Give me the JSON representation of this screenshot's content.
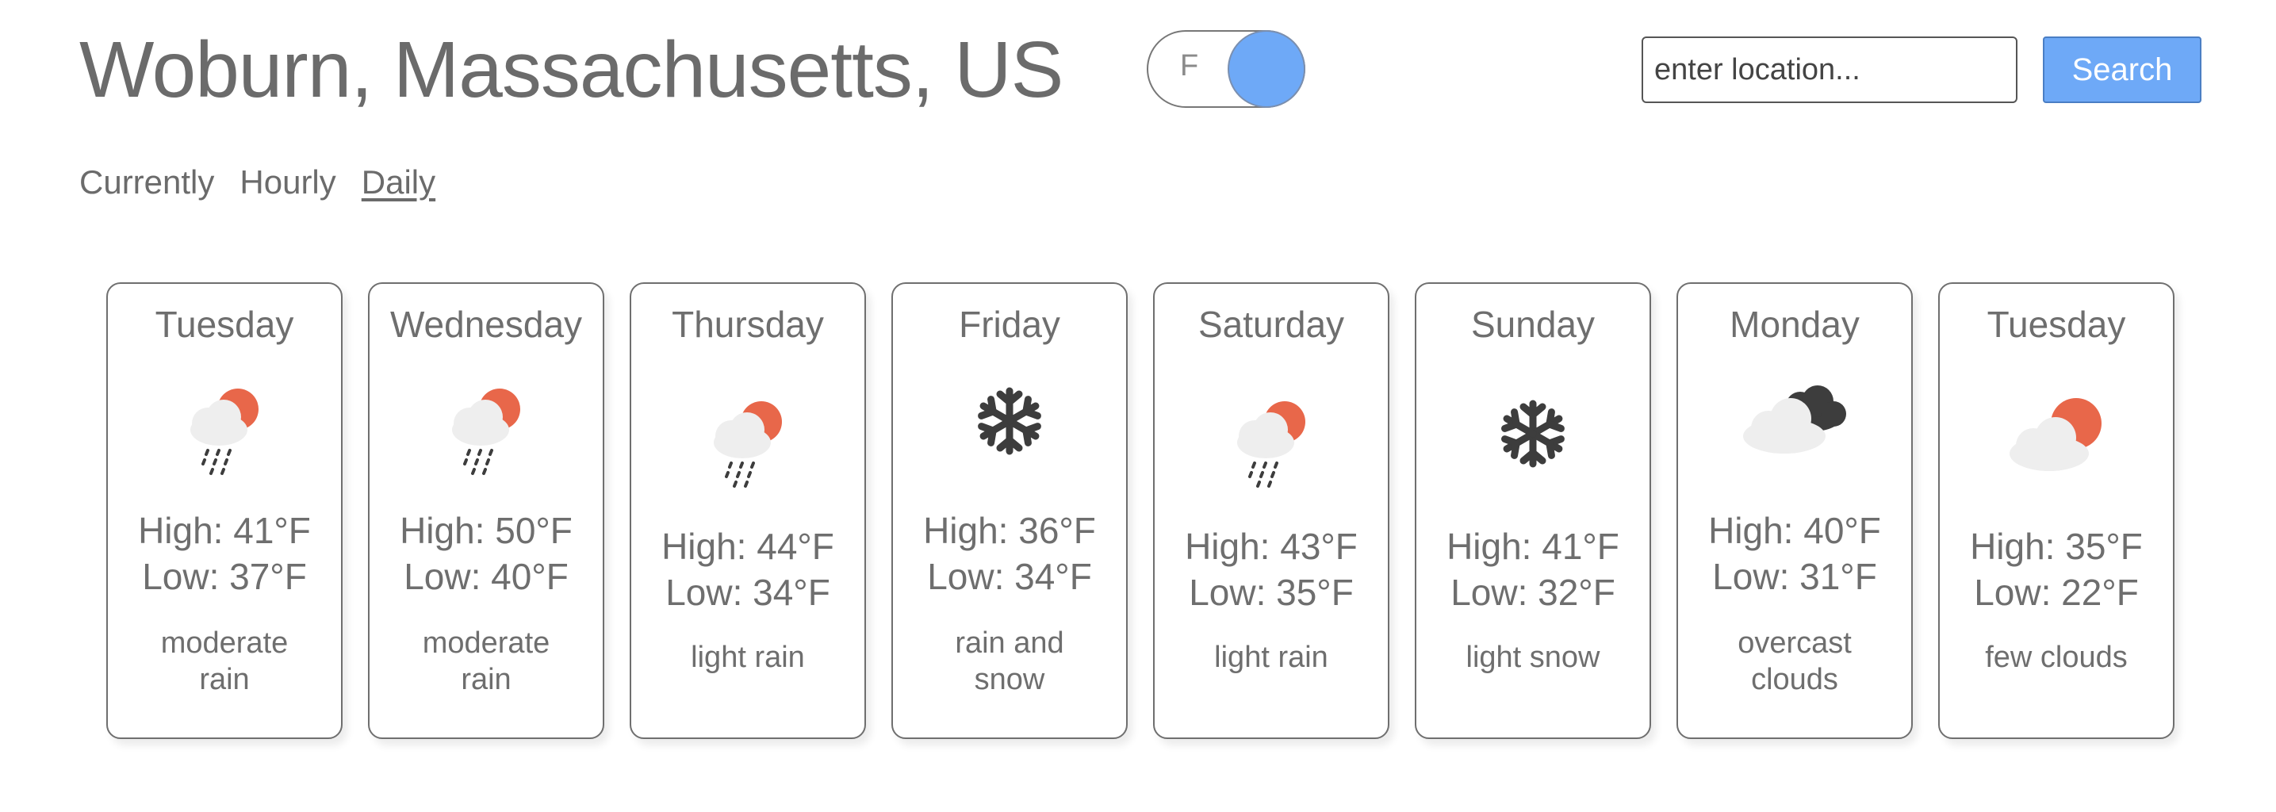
{
  "header": {
    "location": "Woburn, Massachusetts, US",
    "unit_toggle_label": "F",
    "search_placeholder": "enter location...",
    "search_button_label": "Search"
  },
  "tabs": [
    {
      "label": "Currently",
      "active": false
    },
    {
      "label": "Hourly",
      "active": false
    },
    {
      "label": "Daily",
      "active": true
    }
  ],
  "colors": {
    "accent": "#6ea9f7",
    "sun": "#e8674a",
    "cloud": "#eeeeee",
    "dark_cloud": "#3d3d3d"
  },
  "days": [
    {
      "day": "Tuesday",
      "icon": "rain-sun-icon",
      "high": "High: 41°F",
      "low": "Low: 37°F",
      "desc_1": "moderate",
      "desc_2": "rain"
    },
    {
      "day": "Wednesday",
      "icon": "rain-sun-icon",
      "high": "High: 50°F",
      "low": "Low: 40°F",
      "desc_1": "moderate",
      "desc_2": "rain"
    },
    {
      "day": "Thursday",
      "icon": "rain-sun-icon",
      "high": "High: 44°F",
      "low": "Low: 34°F",
      "desc_1": "light rain",
      "desc_2": ""
    },
    {
      "day": "Friday",
      "icon": "snowflake-icon",
      "high": "High: 36°F",
      "low": "Low: 34°F",
      "desc_1": "rain and",
      "desc_2": "snow"
    },
    {
      "day": "Saturday",
      "icon": "rain-sun-icon",
      "high": "High: 43°F",
      "low": "Low: 35°F",
      "desc_1": "light rain",
      "desc_2": ""
    },
    {
      "day": "Sunday",
      "icon": "snowflake-icon",
      "high": "High: 41°F",
      "low": "Low: 32°F",
      "desc_1": "light snow",
      "desc_2": ""
    },
    {
      "day": "Monday",
      "icon": "overcast-clouds-icon",
      "high": "High: 40°F",
      "low": "Low: 31°F",
      "desc_1": "overcast",
      "desc_2": "clouds"
    },
    {
      "day": "Tuesday",
      "icon": "partly-cloudy-icon",
      "high": "High: 35°F",
      "low": "Low: 22°F",
      "desc_1": "few clouds",
      "desc_2": ""
    }
  ]
}
